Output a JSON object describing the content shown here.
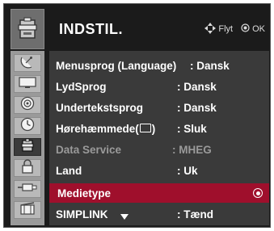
{
  "header": {
    "title": "INDSTIL.",
    "move_hint": "Flyt",
    "ok_hint": "OK"
  },
  "icons": {
    "header": "settings-icon",
    "tabs": [
      "satellite-dish-icon",
      "tv-screen-icon",
      "speaker-icon",
      "clock-icon",
      "settings-icon",
      "lock-icon",
      "usb-plug-icon",
      "film-icon"
    ]
  },
  "menu": {
    "rows": [
      {
        "label": "Menusprog (Language)",
        "value": ": Dansk"
      },
      {
        "label": "LydSprog",
        "value": ": Dansk"
      },
      {
        "label": "Undertekstsprog",
        "value": ": Dansk"
      },
      {
        "label_pre": "Hørehæmmede(",
        "label_post": ")",
        "value": ": Sluk"
      },
      {
        "label": "Data Service",
        "value": ": MHEG"
      },
      {
        "label": "Land",
        "value": ": Uk"
      },
      {
        "label": "Medietype",
        "value": ""
      },
      {
        "label": "SIMPLINK",
        "value": ": Tænd"
      }
    ]
  },
  "colors": {
    "selected_row": "#9f0f2c",
    "panel": "#3a3a3a",
    "background": "#1b1b1b"
  }
}
